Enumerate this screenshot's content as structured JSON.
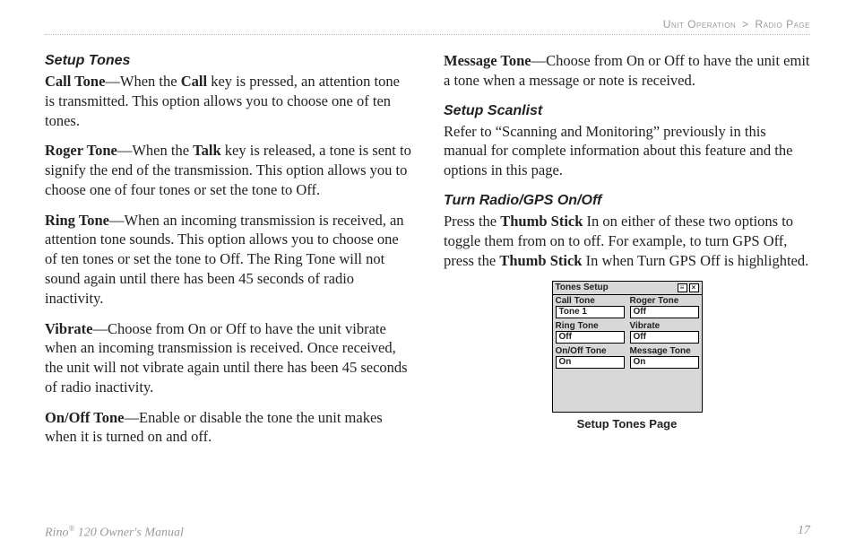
{
  "header": {
    "section": "Unit Operation",
    "sep": ">",
    "subsection": "Radio Page"
  },
  "left": {
    "setupTonesTitle": "Setup Tones",
    "callTone": {
      "lead": "Call Tone",
      "dash": "—When the ",
      "key": "Call",
      "rest": " key is pressed, an attention tone is transmitted. This option allows you to choose one of ten tones."
    },
    "rogerTone": {
      "lead": "Roger Tone",
      "dash": "—When the ",
      "key": "Talk",
      "rest": " key is released, a tone is sent to signify the end of the transmission. This option allows you to choose one of four tones or set the tone to Off."
    },
    "ringTone": {
      "lead": "Ring Tone",
      "rest": "—When an incoming transmission is received, an attention tone sounds. This option allows you to choose one of ten tones or set the tone to Off. The Ring Tone will not sound again until there has been 45 seconds of radio inactivity."
    },
    "vibrate": {
      "lead": "Vibrate",
      "rest": "—Choose from On or Off to have the unit vibrate when an incoming transmission is received. Once received, the unit will not vibrate again until there has been 45 seconds of radio inactivity."
    },
    "onOffTone": {
      "lead": "On/Off Tone",
      "rest": "—Enable or disable the tone the unit makes when it is turned on and off."
    }
  },
  "right": {
    "messageTone": {
      "lead": "Message Tone",
      "rest": "—Choose from On or Off to have the unit emit a tone when a message or note is received."
    },
    "setupScanlistTitle": "Setup Scanlist",
    "scanlistBody": "Refer to “Scanning and Monitoring” previously in this manual for complete information about this feature and the options in this page.",
    "turnRadioTitle": "Turn Radio/GPS On/Off",
    "turnRadio": {
      "p1": "Press the ",
      "k1": "Thumb Stick",
      "p2": " In on either of these two options to toggle them from on to off. For example, to turn GPS Off, press the ",
      "k2": "Thumb Stick",
      "p3": " In when Turn GPS Off is highlighted."
    },
    "figure": {
      "windowTitle": "Tones Setup",
      "icon1": "≡",
      "icon2": "×",
      "rows": [
        {
          "l1": "Call Tone",
          "l2": "Roger Tone",
          "v1": "Tone 1",
          "v2": "Off"
        },
        {
          "l1": "Ring Tone",
          "l2": "Vibrate",
          "v1": "Off",
          "v2": "Off"
        },
        {
          "l1": "On/Off Tone",
          "l2": "Message Tone",
          "v1": "On",
          "v2": "On"
        }
      ],
      "caption": "Setup Tones Page"
    }
  },
  "footer": {
    "product_pre": "Rino",
    "reg": "®",
    "product_post": " 120 Owner's Manual",
    "page": "17"
  }
}
